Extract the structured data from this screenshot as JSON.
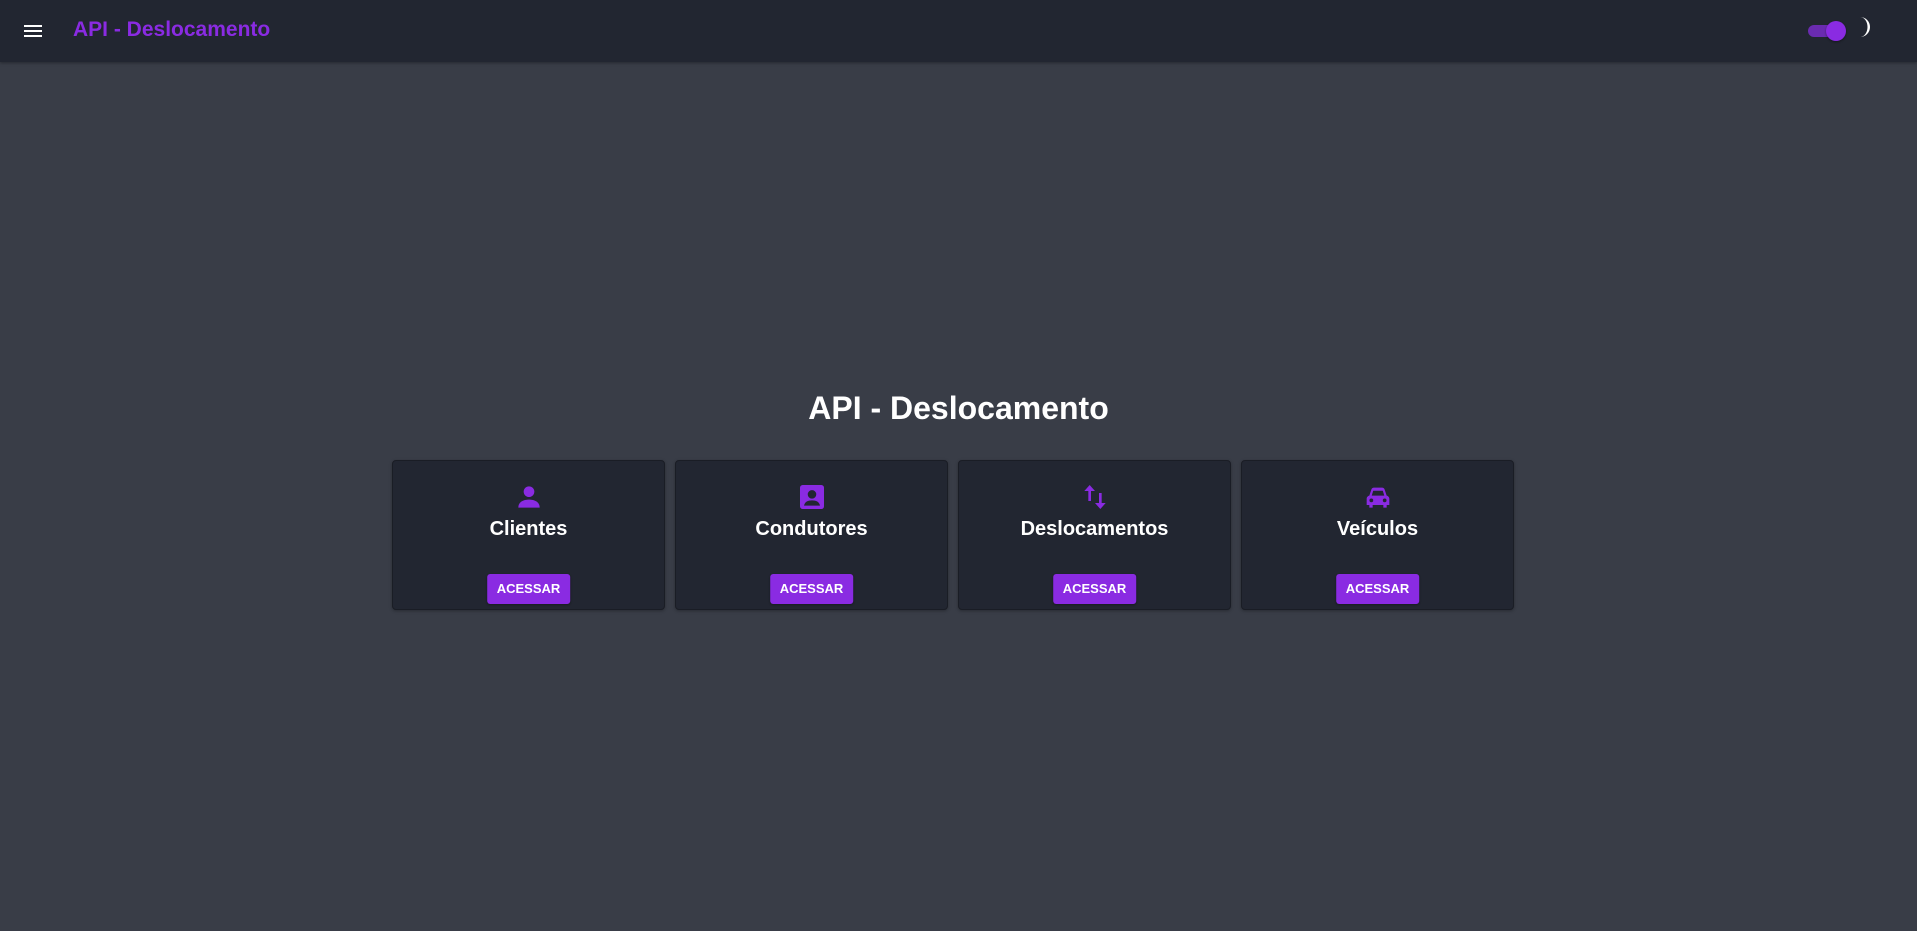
{
  "appbar": {
    "title": "API - Deslocamento",
    "menu_icon": "hamburger-menu-icon",
    "theme_toggle": {
      "checked": true,
      "icon": "moon-icon"
    }
  },
  "main": {
    "title": "API - Deslocamento",
    "cards": [
      {
        "icon": "person-icon",
        "label": "Clientes",
        "button": "ACESSAR"
      },
      {
        "icon": "contact-badge-icon",
        "label": "Condutores",
        "button": "ACESSAR"
      },
      {
        "icon": "swap-vertical-icon",
        "label": "Deslocamentos",
        "button": "ACESSAR"
      },
      {
        "icon": "car-icon",
        "label": "Veículos",
        "button": "ACESSAR"
      }
    ]
  },
  "colors": {
    "accent": "#8a2be2",
    "appbar_bg": "#222631",
    "page_bg": "#393d47",
    "card_bg": "#222631",
    "text": "#ffffff"
  }
}
